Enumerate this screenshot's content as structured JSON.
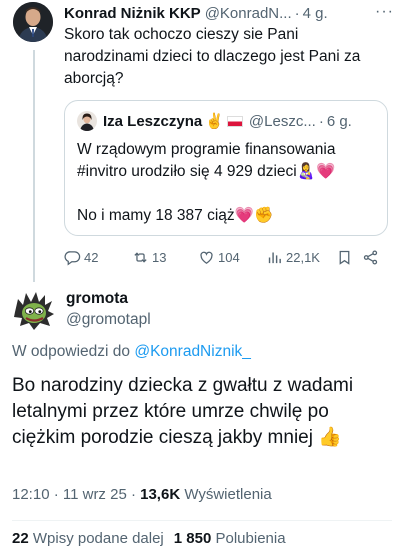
{
  "parent_tweet": {
    "author_name": "Konrad Niżnik KKP",
    "author_handle": "@KonradN...",
    "dot": "·",
    "time": "4 g.",
    "more": "···",
    "text": "Skoro tak ochoczo cieszy sie Pani narodzinami dzieci to dlaczego jest Pani za aborcją?",
    "quoted": {
      "author_name": "Iza Leszczyna",
      "victory_emoji": "✌️",
      "author_handle": "@Leszc...",
      "dot": "·",
      "time": "6 g.",
      "line1": "W rządowym programie finansowania #invitro  urodziło się 4 929 dzieci👩‍🍼💗",
      "line2": "No i mamy 18 387 ciąż💗✊"
    },
    "actions": {
      "replies": "42",
      "reposts": "13",
      "likes": "104",
      "views": "22,1K"
    }
  },
  "main_tweet": {
    "author_name": "gromota",
    "author_handle": "@gromotapl",
    "reply_prefix": "W odpowiedzi do ",
    "reply_handle": "@KonradNiznik_",
    "text": "Bo narodziny dziecka z gwałtu z wadami letalnymi przez które umrze chwilę po ciężkim porodzie cieszą jakby mniej 👍",
    "time": "12:10 · 11 wrz 25 · ",
    "views_count": "13,6K",
    "views_label": " Wyświetlenia",
    "reposts_count": "22",
    "reposts_label": " Wpisy podane dalej",
    "likes_count": "1 850",
    "likes_label": " Polubienia"
  },
  "colors": {
    "text": "#0f1419",
    "secondary": "#536471",
    "link": "#1d9bf0",
    "border": "#cfd9de"
  }
}
